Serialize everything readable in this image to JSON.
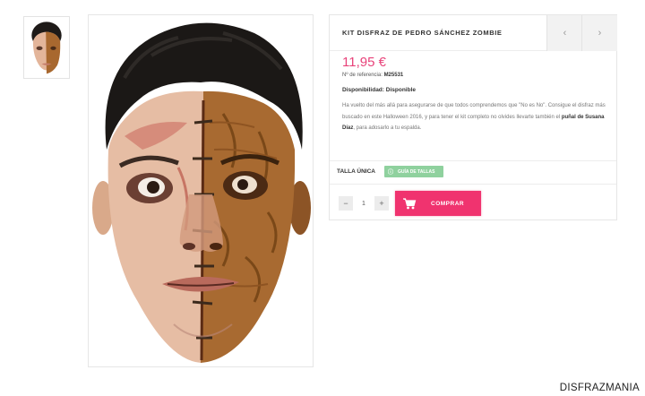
{
  "product": {
    "title": "KIT DISFRAZ DE PEDRO SÁNCHEZ ZOMBIE",
    "price": "11,95 €",
    "reference_label": "Nº de referencia:",
    "reference_value": "M25531",
    "availability_label": "Disponibilidad:",
    "availability_value": "Disponible",
    "description_part1": "Ha vuelto del más allá para asegurarse de que todos comprendemos que \"No es No\". Consigue el disfraz más buscado en este Halloween 2016, y para tener el kit completo no olvides llevarte también el ",
    "description_bold": "puñal de Susana Díaz",
    "description_part2": ", para adosarlo a tu espalda."
  },
  "navigation": {
    "prev_icon": "‹",
    "next_icon": "›"
  },
  "size": {
    "label": "TALLA ÚNICA",
    "guide_button": "GUÍA DE TALLAS"
  },
  "cart": {
    "minus": "−",
    "quantity": "1",
    "plus": "+",
    "buy_label": "COMPRAR"
  },
  "watermark": "DISFRAZMANIA",
  "colors": {
    "accent_pink": "#f0336f",
    "price_pink": "#e8437a",
    "guide_green": "#8fd19e"
  }
}
